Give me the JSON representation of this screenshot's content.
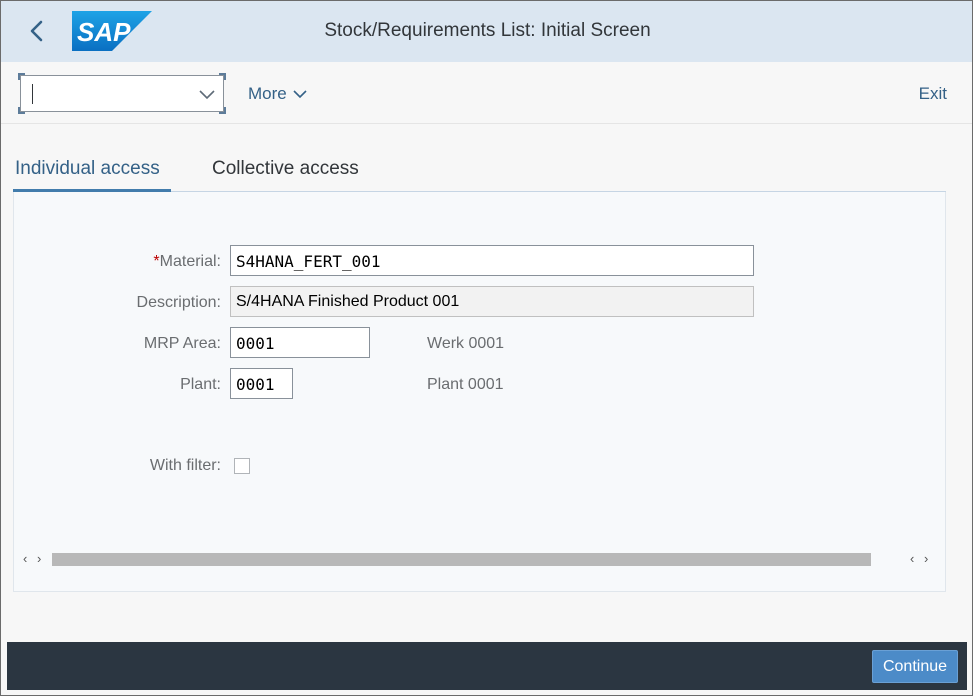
{
  "shell": {
    "title": "Stock/Requirements List: Initial Screen",
    "logo_text": "SAP"
  },
  "toolbar": {
    "ok_code_value": "",
    "more_label": "More",
    "exit_label": "Exit"
  },
  "tabs": [
    {
      "label": "Individual access",
      "active": true
    },
    {
      "label": "Collective access",
      "active": false
    }
  ],
  "form": {
    "material": {
      "label": "Material:",
      "required": "*",
      "value": "S4HANA_FERT_001"
    },
    "description": {
      "label": "Description:",
      "value": "S/4HANA Finished Product 001"
    },
    "mrp_area": {
      "label": "MRP Area:",
      "value": "0001",
      "text": "Werk 0001"
    },
    "plant": {
      "label": "Plant:",
      "value": "0001",
      "text": "Plant 0001"
    },
    "with_filter": {
      "label": "With filter:",
      "checked": false
    }
  },
  "footer": {
    "continue_label": "Continue"
  },
  "colors": {
    "shell_bg": "#dbe6f1",
    "accent": "#346187",
    "footer_bg": "#2b3641",
    "button_bg": "#4c8bc8",
    "required": "#bb0000"
  }
}
